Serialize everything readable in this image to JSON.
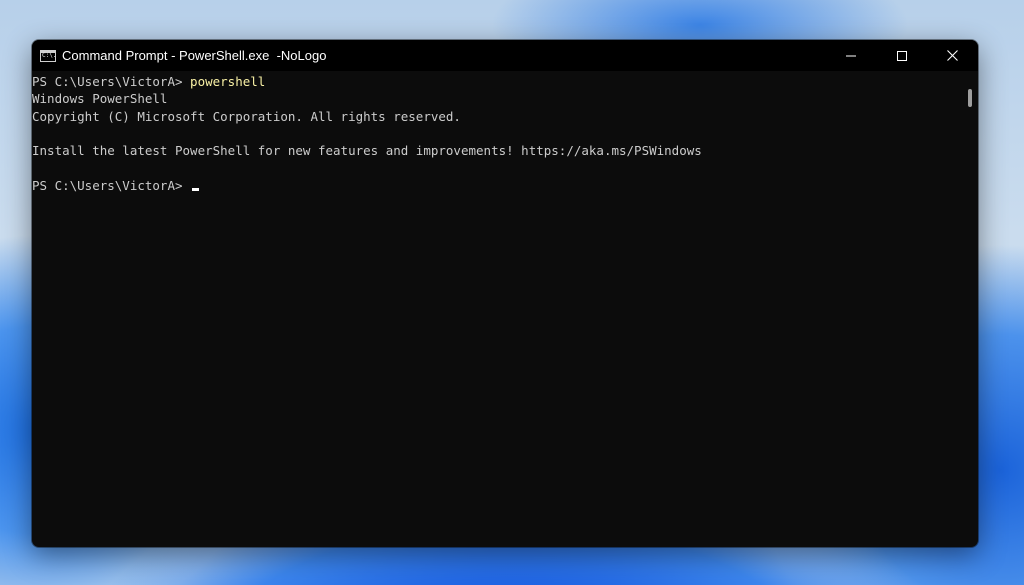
{
  "window": {
    "title": "Command Prompt - PowerShell.exe  -NoLogo",
    "icon_label": "C:\\."
  },
  "caption_buttons": {
    "minimize_icon": "minimize-icon",
    "maximize_icon": "maximize-icon",
    "close_icon": "close-icon"
  },
  "console": {
    "lines": [
      {
        "prompt": "PS C:\\Users\\VictorA> ",
        "command": "powershell"
      },
      {
        "text": "Windows PowerShell"
      },
      {
        "text": "Copyright (C) Microsoft Corporation. All rights reserved."
      },
      {
        "text": ""
      },
      {
        "text": "Install the latest PowerShell for new features and improvements! https://aka.ms/PSWindows"
      },
      {
        "text": ""
      },
      {
        "prompt": "PS C:\\Users\\VictorA> ",
        "command": ""
      }
    ]
  },
  "colors": {
    "console_bg": "#0c0c0c",
    "console_text": "#cccccc",
    "command_text": "#f9f1a5",
    "titlebar_bg": "#000000"
  }
}
